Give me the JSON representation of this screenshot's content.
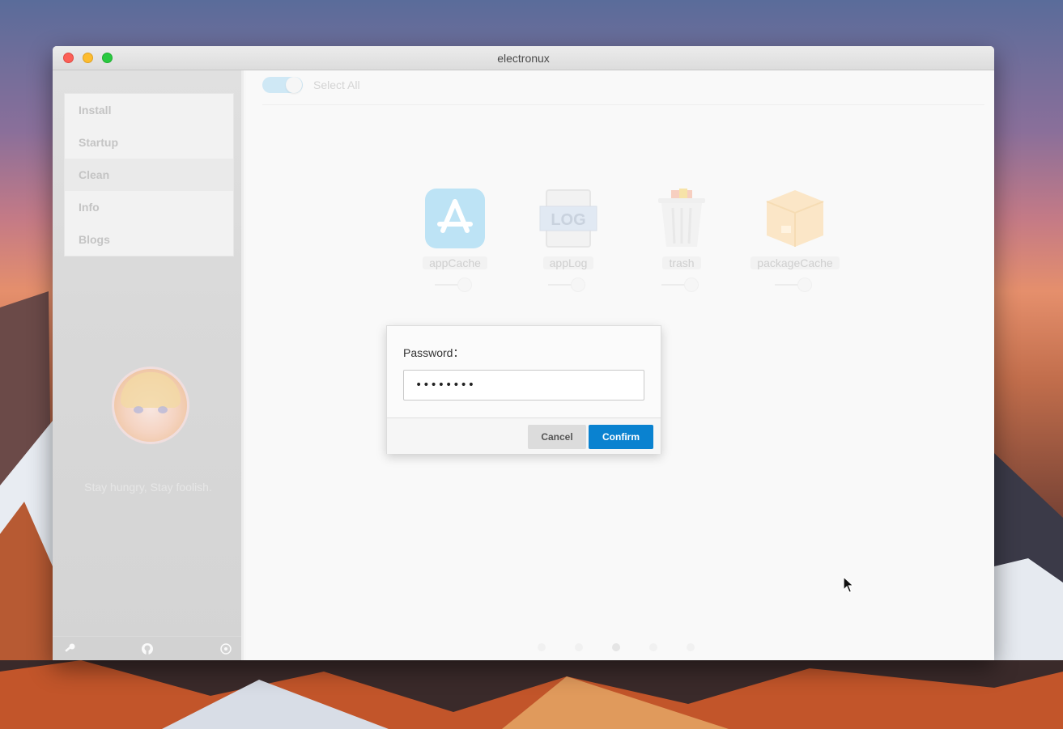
{
  "window": {
    "title": "electronux"
  },
  "sidebar": {
    "items": [
      {
        "label": "Install"
      },
      {
        "label": "Startup"
      },
      {
        "label": "Clean",
        "active": true
      },
      {
        "label": "Info"
      },
      {
        "label": "Blogs"
      }
    ],
    "motto": "Stay hungry, Stay foolish.",
    "footer_icons": [
      "key-icon",
      "github-icon",
      "power-icon"
    ]
  },
  "main": {
    "select_all_label": "Select All",
    "select_all_on": true,
    "clean_items": [
      {
        "label": "appCache",
        "icon": "app-store-icon"
      },
      {
        "label": "appLog",
        "icon": "log-icon"
      },
      {
        "label": "trash",
        "icon": "trash-icon"
      },
      {
        "label": "packageCache",
        "icon": "package-icon"
      }
    ],
    "page_dots": 5,
    "current_page": 3
  },
  "dialog": {
    "label": "Password：",
    "input_value": "••••••••",
    "cancel_label": "Cancel",
    "confirm_label": "Confirm"
  },
  "colors": {
    "accent": "#0a82d0",
    "toggle_on": "#cfe8f5"
  }
}
